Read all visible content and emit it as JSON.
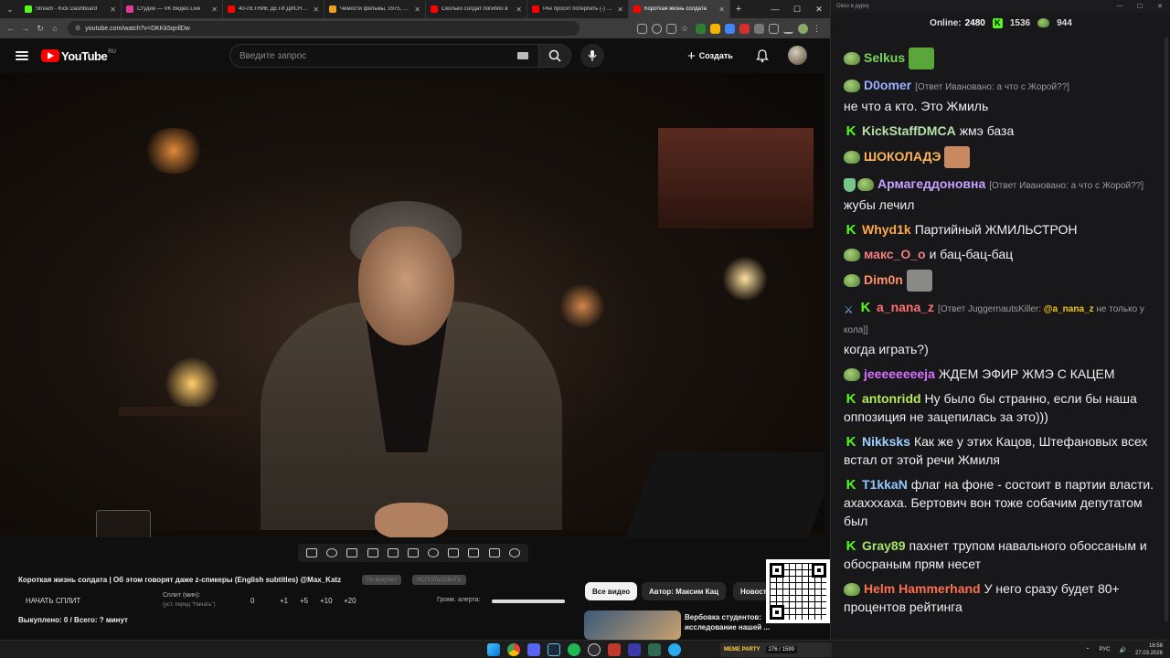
{
  "browser": {
    "tabs": [
      {
        "title": "Stream - Kick Dashboard",
        "color": "#53fc18",
        "active": false
      },
      {
        "title": "Студия — VK Видео Live",
        "color": "#e33b8f",
        "active": false
      },
      {
        "title": "40-ЛЕТНИЕ ДЕТИ ДИСНЕЯ",
        "color": "#ff0000",
        "active": false
      },
      {
        "title": "Чемости фильмы, 1975, дата",
        "color": "#f0a020",
        "active": false
      },
      {
        "title": "Сколько солдат погибло в",
        "color": "#ff0000",
        "active": false
      },
      {
        "title": "Ркн просит потерпеть (-) - Y",
        "color": "#ff0000",
        "active": false
      },
      {
        "title": "Короткая жизнь солдата",
        "color": "#ff0000",
        "active": true
      }
    ],
    "url": "youtube.com/watch?v=DKKk5qnllDw"
  },
  "youtube": {
    "logo_text": "YouTube",
    "country_code": "RU",
    "search_placeholder": "Введите запрос",
    "create_label": "Создать"
  },
  "below_video": {
    "title": "Короткая жизнь солдата | Об этом говорят даже z-спикеры (English subtitles) @Max_Katz",
    "pill_1": "Не выкупил",
    "pill_2": "ИСПОЛЬЗОВАТЬ",
    "start_split": "НАЧАТЬ СПЛИТ",
    "split_label": "Сплит (мин):",
    "split_sub": "(уст. перед \"Начать\")",
    "split_value": "0",
    "increments": [
      "+1",
      "+5",
      "+10",
      "+20"
    ],
    "volume_label": "Громк. алерта:",
    "volume_fraction": 1.0,
    "bought": "Выкуплено: 0 / Всего: ? минут",
    "chips": [
      "Все видео",
      "Автор: Максим Кац",
      "Новост"
    ],
    "rec_title_1": "Вербовка студентов:",
    "rec_title_2": "исследование нашей ..."
  },
  "chat": {
    "window_title": "Окно в дурку",
    "online_label": "Online:",
    "online_count": "2480",
    "kick_count": "1536",
    "vk_count": "944",
    "messages": [
      {
        "badges": [
          "pepe"
        ],
        "user": "Selkus",
        "color": "#7cd35a",
        "text": "",
        "emote": "#5aa63a"
      },
      {
        "badges": [
          "pepe"
        ],
        "user": "D0omer",
        "color": "#9ab0ff",
        "reply": "[Ответ Ивановано: а что с Жорой??]",
        "text": "не что а кто. Это Жмиль"
      },
      {
        "badges": [
          "k"
        ],
        "user": "KickStaffDMCA",
        "color": "#b6e2a8",
        "text": "жмэ база"
      },
      {
        "badges": [
          "pepe"
        ],
        "user": "ШОКОЛАДЭ",
        "color": "#ffb35c",
        "text": "",
        "emote": "#c88860"
      },
      {
        "badges": [
          "shield",
          "pepe"
        ],
        "user": "Армагеддоновна",
        "color": "#c7a2ff",
        "reply": "[Ответ Ивановано: а что с Жорой??]",
        "text": "жубы лечил"
      },
      {
        "badges": [
          "k"
        ],
        "user": "Whyd1k",
        "color": "#ffa94d",
        "text": "Партийный ЖМИЛЬСТРОН"
      },
      {
        "badges": [
          "pepe"
        ],
        "user": "макс_О_о",
        "color": "#f07f7f",
        "text": "и бац-бац-бац"
      },
      {
        "badges": [
          "pepe"
        ],
        "user": "Dim0n",
        "color": "#ff8f6a",
        "text": "",
        "emote": "#8a8a88"
      },
      {
        "badges": [
          "sword",
          "k"
        ],
        "user": "a_nana_z",
        "color": "#ff6f6f",
        "reply_prefix": "[Ответ JuggernautsKiller:",
        "reply_mention": "@a_nana_z",
        "reply_suffix": "не только у кола]]",
        "text": "когда играть?)"
      },
      {
        "badges": [
          "pepe"
        ],
        "user": "jeeeeeeeeja",
        "color": "#d870ff",
        "text": "ЖДЕМ ЭФИР ЖМЭ С КАЦЕМ"
      },
      {
        "badges": [
          "k"
        ],
        "user": "antonridd",
        "color": "#b5e85a",
        "text": "Ну было бы странно, если бы наша оппозиция не зацепилась за это)))"
      },
      {
        "badges": [
          "k"
        ],
        "user": "Nikksks",
        "color": "#9fd0ff",
        "text": "Как же у этих Кацов, Штефановых всех встал от этой речи Жмиля"
      },
      {
        "badges": [
          "k"
        ],
        "user": "T1kkaN",
        "color": "#8fc8ff",
        "text": "флаг на фоне - состоит в партии власти. ахахххаха. Бертович вон тоже собачим депутатом был"
      },
      {
        "badges": [
          "k"
        ],
        "user": "Gray89",
        "color": "#a6e36a",
        "text": "пахнет трупом навального обоссаным и обосраным прям несет"
      },
      {
        "badges": [
          "pepe"
        ],
        "user": "Helm Hammerhand",
        "color": "#ff6f4f",
        "text": "У него сразу будет 80+ процентов рейтинга"
      }
    ]
  },
  "taskbar": {
    "meme_label": "МЕМЕ PARTY",
    "meme_count": "276 / 1599",
    "lang": "РУС",
    "time": "16:58",
    "date": "27.03.2026"
  }
}
